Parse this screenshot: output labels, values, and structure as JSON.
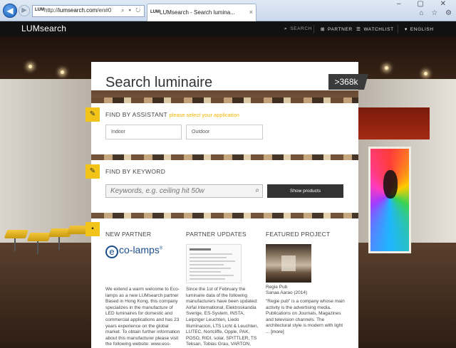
{
  "browser": {
    "url_prefix": "http://",
    "url_host": "lumsearch.com",
    "url_path": "/en#0",
    "address_tools": "⌕ ▾ ↻",
    "tab_favicon": "LUM",
    "tab_title": "LUMsearch - Search lumina...",
    "tab_close": "×",
    "window_controls": "– ▢ ✕",
    "toolbar_icons": "⌂ ☆ ⚙"
  },
  "header": {
    "logo": "LUMsearch",
    "nav_search": "SEARCH",
    "nav_partner": "PARTNER",
    "nav_watchlist": "WATCHLIST",
    "nav_language": "ENGLISH"
  },
  "search": {
    "title": "Search luminaire",
    "count_badge": ">368k"
  },
  "assistant": {
    "title": "FIND BY ASSISTANT",
    "hint": "please select your application",
    "option_indoor": "Indoor",
    "option_outdoor": "Outdoor"
  },
  "keyword": {
    "title": "FIND BY KEYWORD",
    "placeholder": "Keywords, e.g. ceiling hit 50w",
    "button": "Show products"
  },
  "news": {
    "partner_title": "NEW PARTNER",
    "partner_logo_text": "co-lamps",
    "partner_logo_letter": "e",
    "partner_logo_mark": "®",
    "partner_text": "We extend a warm welcome to Eco-lamps as a new LUMsearch partner Based in Hong Kong, this company specializes in the manufacture of LED luminaires for domestic and commercial applications and has 23 years experience on the global market. To obtain further information about this manufacturer please visit the following website: www.eco-lamps.com",
    "updates_title": "PARTNER UPDATES",
    "updates_text": "Since the 1st of February the luminaire data of the following manufacturers have been updated: Airfal International, Elektroskandia Sverige, ES-System, INSTA, Leipziger Leuchten, Liedo Illuminacion, LTS Licht & Leuchten, LUTEC, Nortcliffe, Opple, PAK, POSO, RIDI, solar, SPITTLER, TS Teksan, Tobias Grau, VARTON, VESTEL, WILA, Kosnic",
    "project_title": "FEATURED PROJECT",
    "project_name": "Regie Pub",
    "project_author": "Sanaa Aarao (2014)",
    "project_text": "\"Regie pub\" is a company whose main activity is the advertising media. Publications on Journals, Magazines and television channels. The architectural style is modern with light ...",
    "project_more": "[more]"
  },
  "icons": {
    "back": "arrow-left-icon",
    "forward": "arrow-right-icon",
    "search": "magnifier-icon",
    "partner": "plus-square-icon",
    "watchlist": "list-icon",
    "language": "caret-down-icon",
    "assistant": "magic-wand-icon",
    "keyword": "pencil-icon",
    "news": "speech-bubble-icon"
  },
  "colors": {
    "accent": "#f2c318",
    "header_bg": "#111111",
    "button_bg": "#333333"
  }
}
